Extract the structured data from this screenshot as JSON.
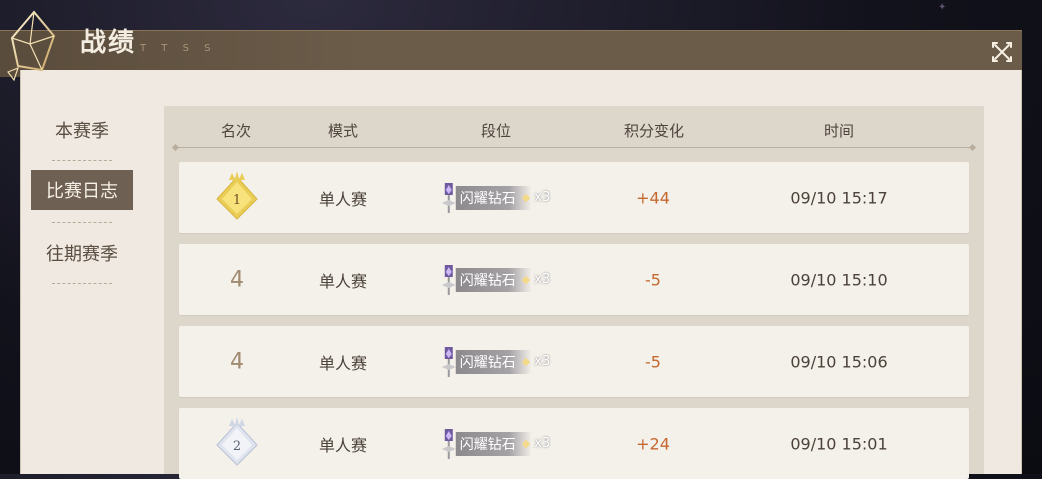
{
  "header": {
    "title": "战绩",
    "decoration": "T T S S"
  },
  "sidebar": {
    "items": [
      {
        "label": "本赛季",
        "active": false
      },
      {
        "label": "比赛日志",
        "active": true
      },
      {
        "label": "往期赛季",
        "active": false
      }
    ]
  },
  "table": {
    "columns": [
      "名次",
      "模式",
      "段位",
      "积分变化",
      "时间"
    ],
    "rows": [
      {
        "rank": "1",
        "rank_badge": "gold-diamond",
        "mode": "单人赛",
        "tier": "闪耀钻石",
        "tier_count": "x3",
        "score": "+44",
        "time": "09/10  15:17"
      },
      {
        "rank": "4",
        "rank_badge": "none",
        "mode": "单人赛",
        "tier": "闪耀钻石",
        "tier_count": "x3",
        "score": "-5",
        "time": "09/10  15:10"
      },
      {
        "rank": "4",
        "rank_badge": "none",
        "mode": "单人赛",
        "tier": "闪耀钻石",
        "tier_count": "x3",
        "score": "-5",
        "time": "09/10  15:06"
      },
      {
        "rank": "2",
        "rank_badge": "silver-diamond",
        "mode": "单人赛",
        "tier": "闪耀钻石",
        "tier_count": "x3",
        "score": "+24",
        "time": "09/10  15:01"
      }
    ]
  },
  "colors": {
    "accent": "#c5682e",
    "active_nav": "#6e6053",
    "panel": "#efe9e1",
    "gold": "#e9cd55",
    "silver": "#cfd6e6"
  },
  "icons": {
    "close": "close-icon",
    "crystal": "crystal-icon",
    "tier": "diamond-tier-icon",
    "tier_star": "star-icon"
  }
}
